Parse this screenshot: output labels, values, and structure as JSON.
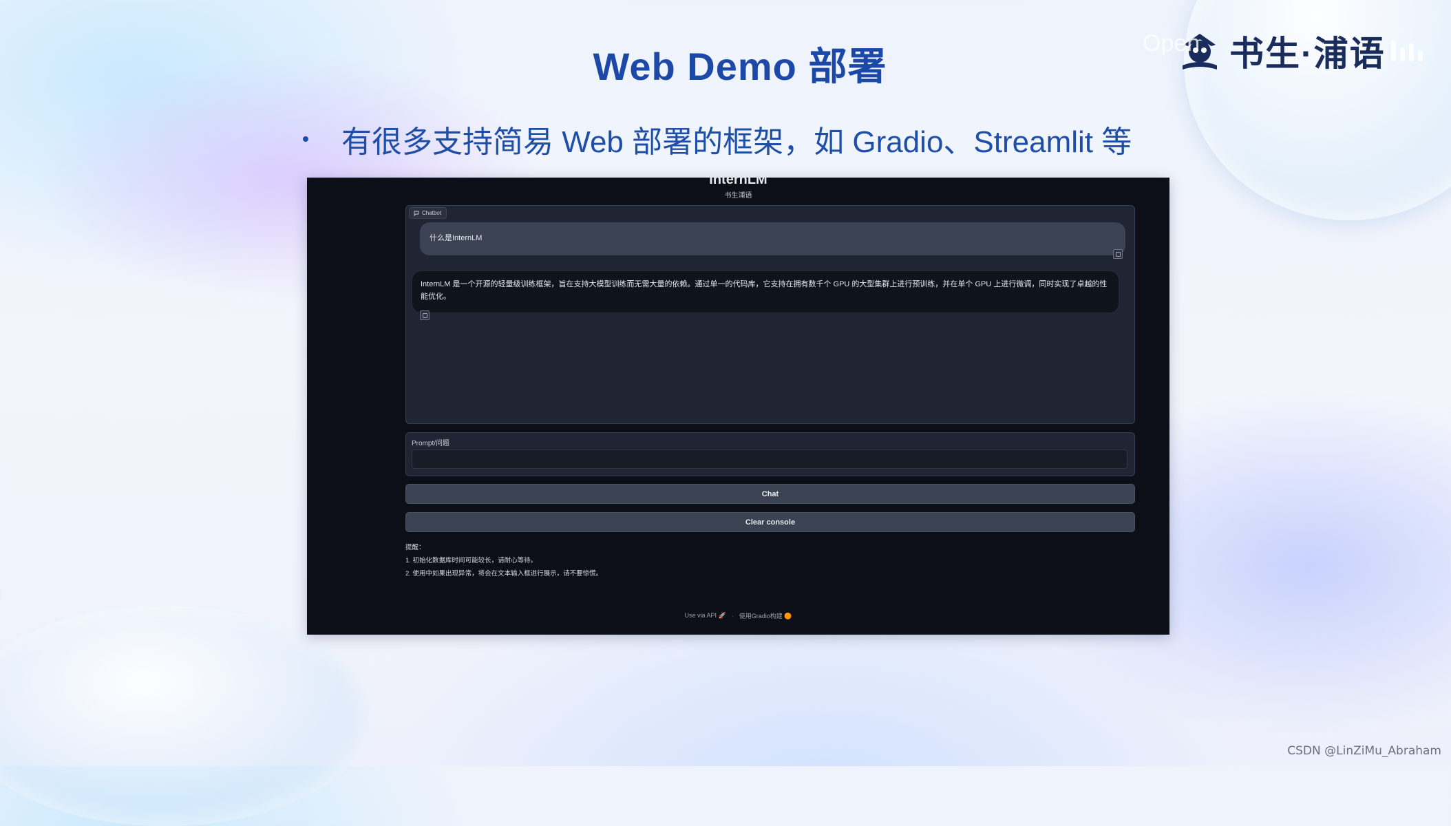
{
  "slide": {
    "title": "Web Demo 部署",
    "bullet": "有很多支持简易 Web 部署的框架，如 Gradio、Streamlit 等"
  },
  "logo": {
    "text": "书生·浦语",
    "faint_text": "Open"
  },
  "app": {
    "title": "InternLM",
    "subtitle": "书生浦语",
    "chatbot_label": "Chatbot",
    "messages": [
      {
        "role": "user",
        "text": "什么是InternLM"
      },
      {
        "role": "bot",
        "text": "InternLM 是一个开源的轻量级训练框架，旨在支持大模型训练而无需大量的依赖。通过单一的代码库，它支持在拥有数千个 GPU 的大型集群上进行预训练，并在单个 GPU 上进行微调，同时实现了卓越的性能优化。"
      }
    ],
    "prompt_label": "Prompt/问题",
    "prompt_value": "",
    "chat_button": "Chat",
    "clear_button": "Clear console",
    "notes_title": "提醒：",
    "notes": [
      "1. 初始化数据库时间可能较长，请耐心等待。",
      "2. 使用中如果出现异常，将会在文本输入框进行展示，请不要惊慌。"
    ],
    "footer_api": "Use via API",
    "footer_sep": "·",
    "footer_built": "使用Gradio构建"
  },
  "watermark": "CSDN @LinZiMu_Abraham",
  "icons": {
    "chatbot": "chat-bubble-icon",
    "copy": "copy-icon",
    "api": "rocket-icon",
    "gradio": "gradio-logo-icon"
  }
}
